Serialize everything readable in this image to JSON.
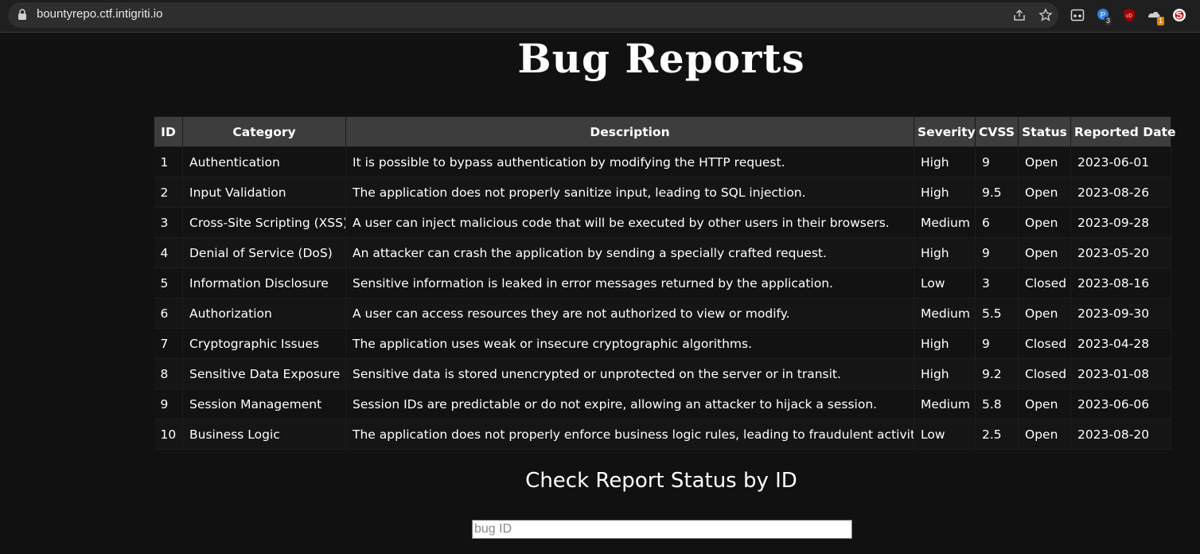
{
  "browser": {
    "url": "bountyrepo.ctf.intigriti.io",
    "extension_badges": [
      "3",
      "1"
    ],
    "icons": [
      "lock-icon",
      "share-icon",
      "star-icon",
      "extension-icon",
      "extension-icon",
      "ublock-icon",
      "extension-icon",
      "profile-icon"
    ]
  },
  "page": {
    "title": "Bug Reports",
    "table": {
      "headers": [
        "ID",
        "Category",
        "Description",
        "Severity",
        "CVSS",
        "Status",
        "Reported Date"
      ],
      "rows": [
        {
          "id": "1",
          "category": "Authentication",
          "description": "It is possible to bypass authentication by modifying the HTTP request.",
          "severity": "High",
          "cvss": "9",
          "status": "Open",
          "date": "2023-06-01"
        },
        {
          "id": "2",
          "category": "Input Validation",
          "description": "The application does not properly sanitize input, leading to SQL injection.",
          "severity": "High",
          "cvss": "9.5",
          "status": "Open",
          "date": "2023-08-26"
        },
        {
          "id": "3",
          "category": "Cross-Site Scripting (XSS)",
          "description": "A user can inject malicious code that will be executed by other users in their browsers.",
          "severity": "Medium",
          "cvss": "6",
          "status": "Open",
          "date": "2023-09-28"
        },
        {
          "id": "4",
          "category": "Denial of Service (DoS)",
          "description": "An attacker can crash the application by sending a specially crafted request.",
          "severity": "High",
          "cvss": "9",
          "status": "Open",
          "date": "2023-05-20"
        },
        {
          "id": "5",
          "category": "Information Disclosure",
          "description": "Sensitive information is leaked in error messages returned by the application.",
          "severity": "Low",
          "cvss": "3",
          "status": "Closed",
          "date": "2023-08-16"
        },
        {
          "id": "6",
          "category": "Authorization",
          "description": "A user can access resources they are not authorized to view or modify.",
          "severity": "Medium",
          "cvss": "5.5",
          "status": "Open",
          "date": "2023-09-30"
        },
        {
          "id": "7",
          "category": "Cryptographic Issues",
          "description": "The application uses weak or insecure cryptographic algorithms.",
          "severity": "High",
          "cvss": "9",
          "status": "Closed",
          "date": "2023-04-28"
        },
        {
          "id": "8",
          "category": "Sensitive Data Exposure",
          "description": "Sensitive data is stored unencrypted or unprotected on the server or in transit.",
          "severity": "High",
          "cvss": "9.2",
          "status": "Closed",
          "date": "2023-01-08"
        },
        {
          "id": "9",
          "category": "Session Management",
          "description": "Session IDs are predictable or do not expire, allowing an attacker to hijack a session.",
          "severity": "Medium",
          "cvss": "5.8",
          "status": "Open",
          "date": "2023-06-06"
        },
        {
          "id": "10",
          "category": "Business Logic",
          "description": "The application does not properly enforce business logic rules, leading to fraudulent activity.",
          "severity": "Low",
          "cvss": "2.5",
          "status": "Open",
          "date": "2023-08-20"
        }
      ]
    },
    "status_check": {
      "heading": "Check Report Status by ID",
      "input_placeholder": "bug ID",
      "input_value": ""
    }
  },
  "colors": {
    "background": "#111111",
    "header_bg": "#3d3d3d",
    "text": "#ffffff"
  }
}
